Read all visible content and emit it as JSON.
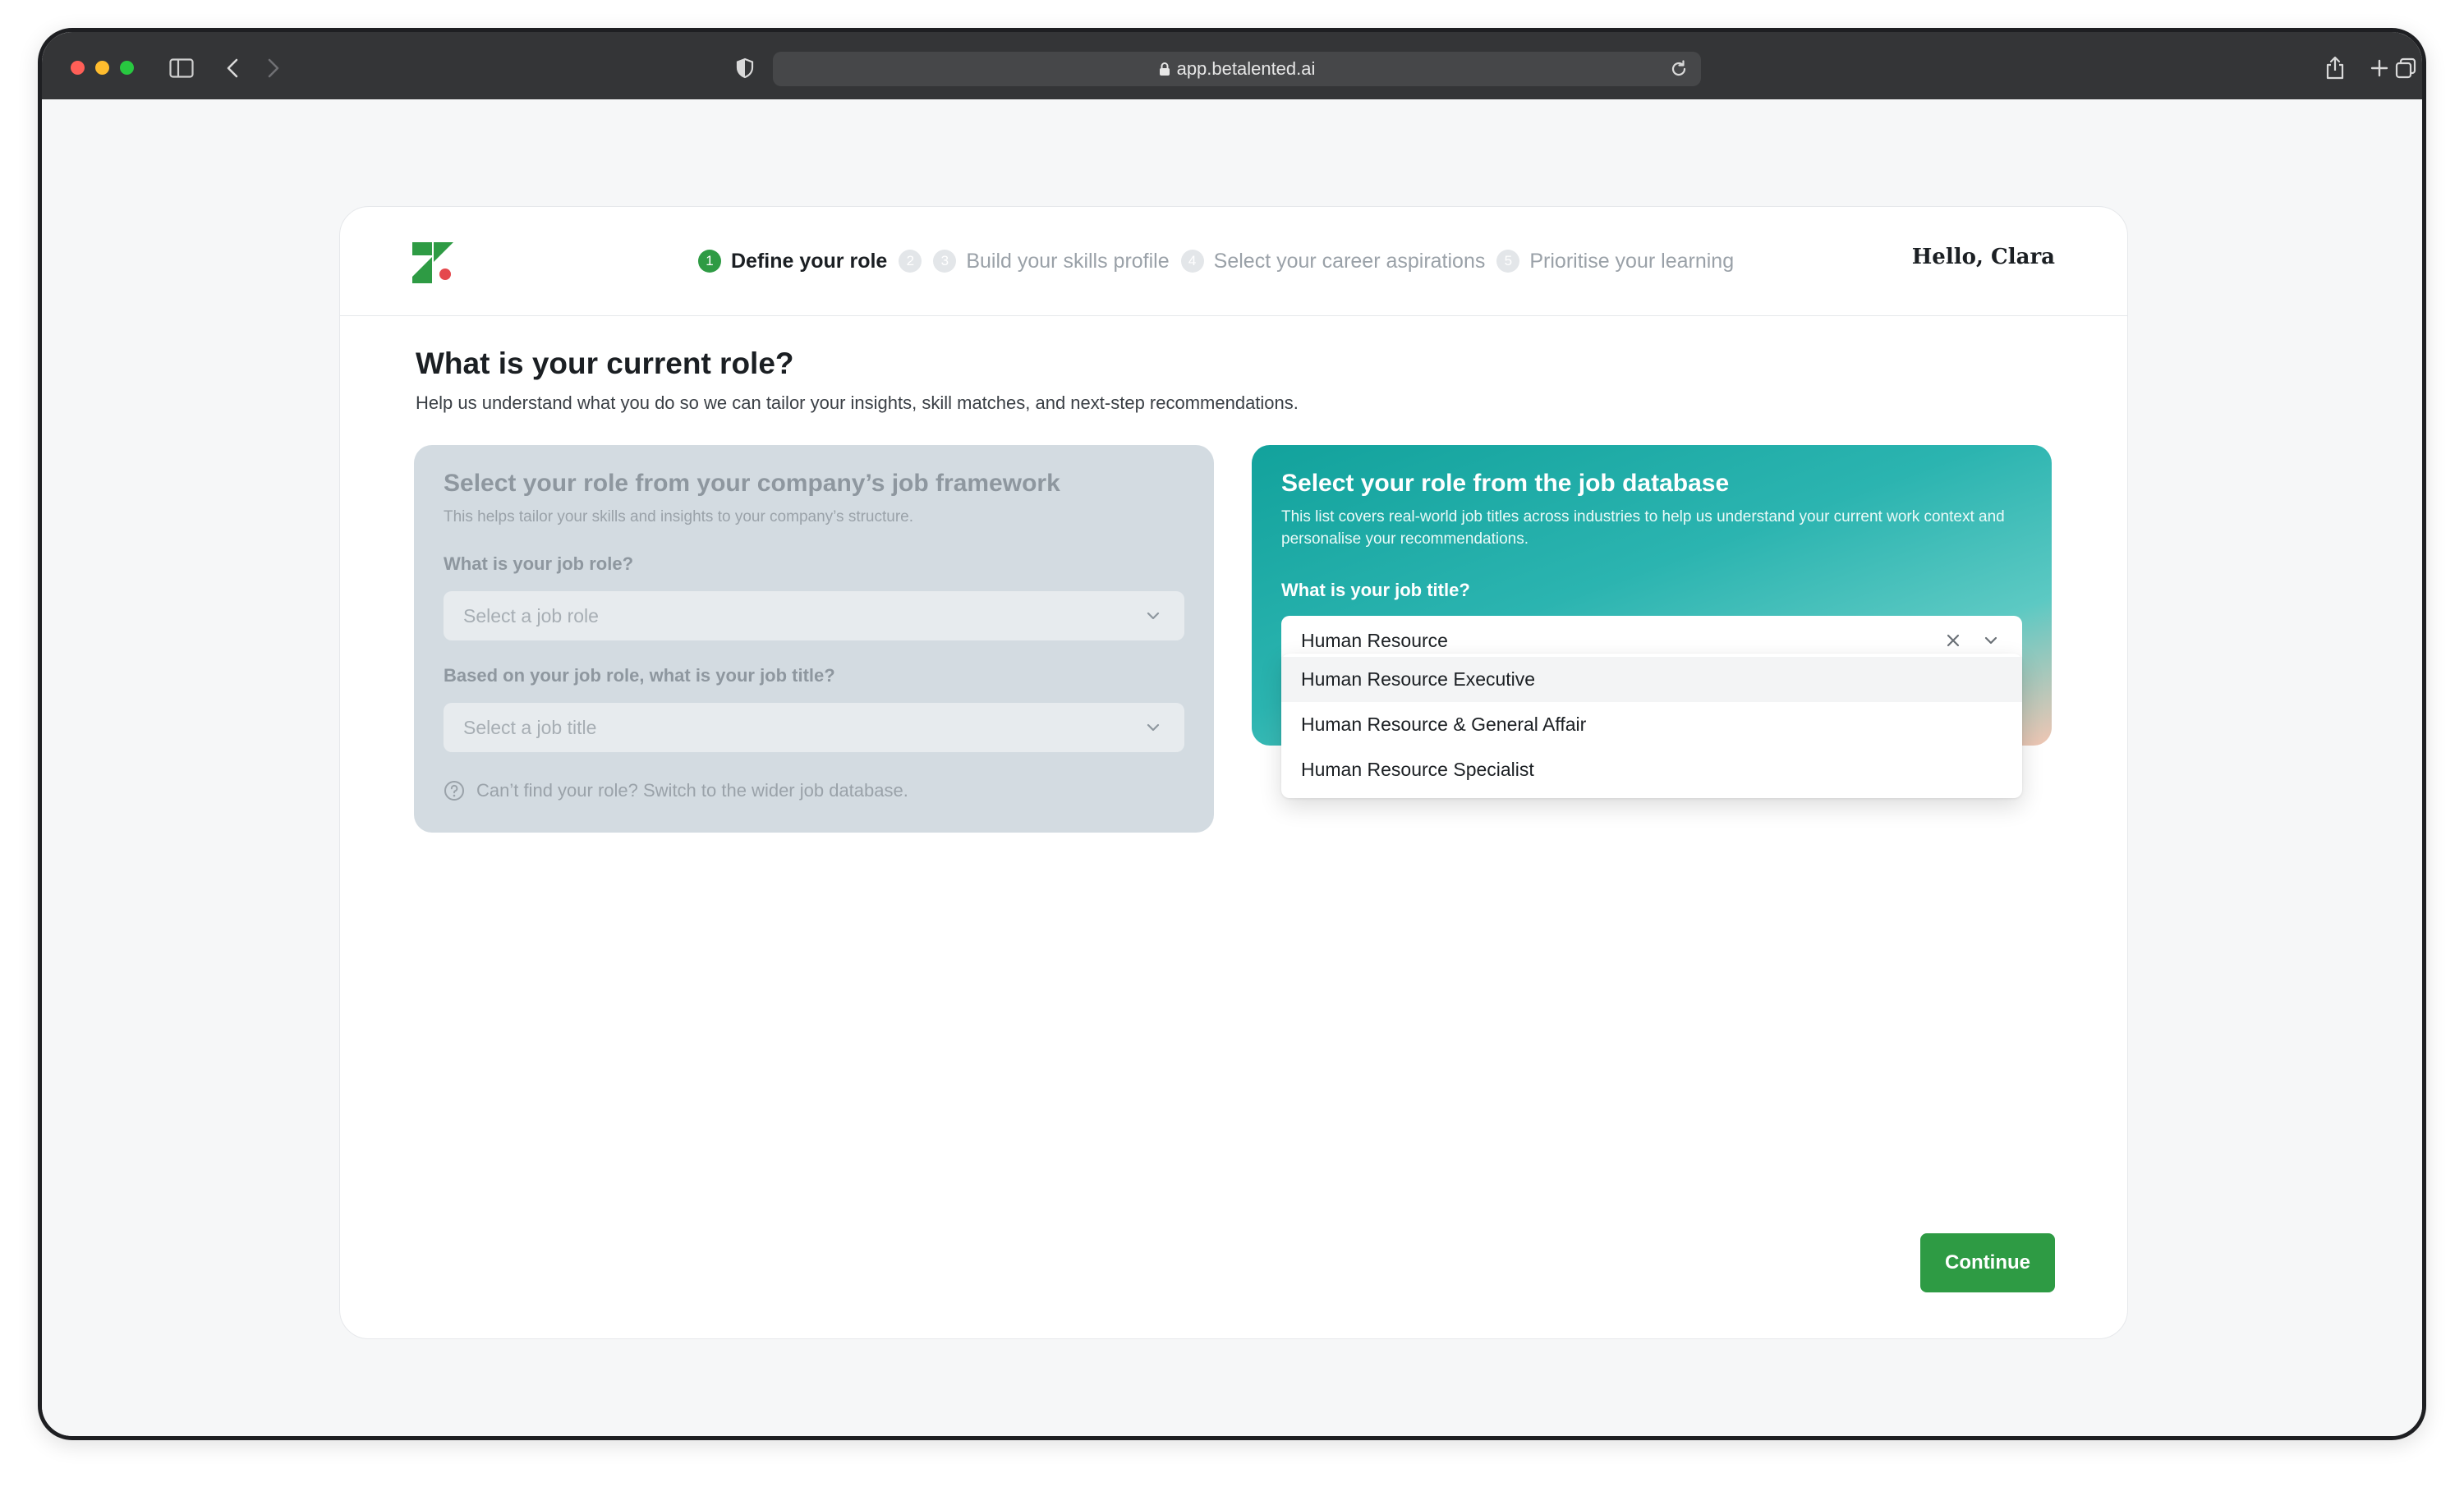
{
  "browser": {
    "url": "app.betalented.ai"
  },
  "header": {
    "steps": [
      {
        "num": "1",
        "label": "Define your role"
      },
      {
        "num": "2",
        "label": ""
      },
      {
        "num": "3",
        "label": "Build your skills profile"
      },
      {
        "num": "4",
        "label": "Select your career aspirations"
      },
      {
        "num": "5",
        "label": "Prioritise your learning"
      }
    ],
    "greeting": "Hello, Clara"
  },
  "main": {
    "title": "What is your current role?",
    "subtitle": "Help us understand what you do so we can tailor your insights, skill matches, and next-step recommendations."
  },
  "framework_panel": {
    "title": "Select your role from your company’s job framework",
    "description": "This helps tailor your skills and insights to your company’s structure.",
    "role_label": "What is your job role?",
    "role_placeholder": "Select a job role",
    "title_label": "Based on your job role, what is your job title?",
    "title_placeholder": "Select a job title",
    "help_text": "Can’t find your role? Switch to the wider job database."
  },
  "database_panel": {
    "title": "Select your role from the job database",
    "description": "This list covers real-world job titles across industries to help us understand your current work context and personalise your recommendations.",
    "field_label": "What is your job title?",
    "input_value": "Human Resource",
    "options": [
      "Human Resource Executive",
      "Human Resource & General Affair",
      "Human Resource Specialist"
    ]
  },
  "footer": {
    "continue_label": "Continue"
  },
  "colors": {
    "accent": "#2e9b44",
    "teal": "#12a29c"
  }
}
